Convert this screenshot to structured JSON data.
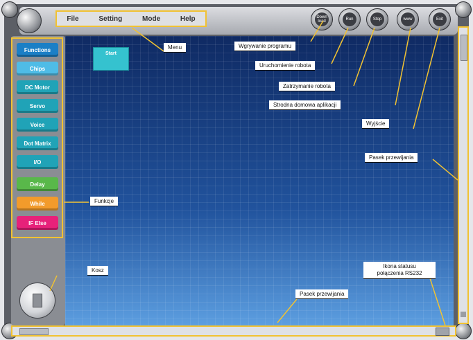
{
  "menu": {
    "items": [
      "File",
      "Setting",
      "Mode",
      "Help"
    ]
  },
  "toolbar": {
    "buttons": [
      {
        "label": "Down load",
        "icon": "download-icon"
      },
      {
        "label": "Run",
        "icon": "run-icon"
      },
      {
        "label": "Stop",
        "icon": "stop-icon"
      },
      {
        "label": "www",
        "icon": "web-icon"
      },
      {
        "label": "Exit",
        "icon": "exit-icon"
      }
    ]
  },
  "functions": {
    "items": [
      {
        "label": "Functions",
        "color": "#1b7fc6"
      },
      {
        "label": "Chips",
        "color": "#4fbce6"
      },
      {
        "label": "DC Motor",
        "color": "#20a3b7"
      },
      {
        "label": "Servo",
        "color": "#20a3b7"
      },
      {
        "label": "Voice",
        "color": "#20a3b7"
      },
      {
        "label": "Dot Matrix",
        "color": "#20a3b7"
      },
      {
        "label": "I/O",
        "color": "#20a3b7"
      },
      {
        "label": "Delay",
        "color": "#59b84a"
      },
      {
        "label": "While",
        "color": "#f29b2b"
      },
      {
        "label": "IF Else",
        "color": "#e7217a"
      }
    ]
  },
  "canvas": {
    "start_block": "Start"
  },
  "annotations": {
    "menu": "Menu",
    "upload": "Wgrywanie programu",
    "run": "Uruchomienie robota",
    "stop": "Zatrzymanie robota",
    "home": "Strodna domowa aplikacji",
    "exit": "Wyjście",
    "vscroll": "Pasek przewijania",
    "functions": "Funkcje",
    "trash": "Kosz",
    "status_line1": "Ikona statusu",
    "status_line2": "połączenia RS232",
    "hscroll": "Pasek przewijania"
  }
}
